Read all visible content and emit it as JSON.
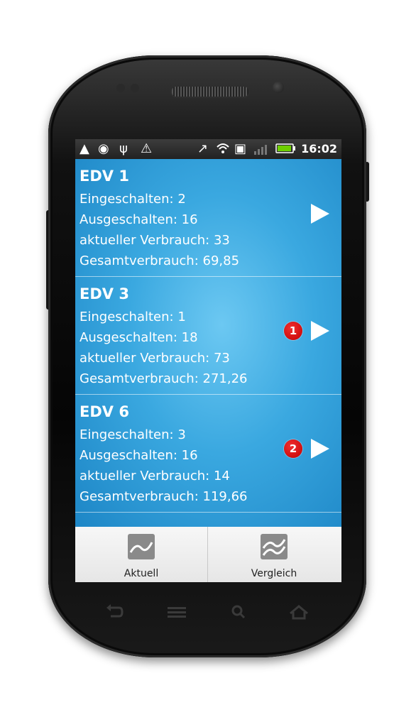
{
  "status_bar": {
    "time": "16:02",
    "icons": [
      "warning-icon",
      "location-icon",
      "usb-icon",
      "alert-icon",
      "missed-call-icon",
      "wifi-icon",
      "sim-icon",
      "signal-icon",
      "battery-icon"
    ]
  },
  "items": [
    {
      "title": "EDV 1",
      "eingeschalten": "Eingeschalten: 2",
      "ausgeschalten": "Ausgeschalten: 16",
      "verbrauch": "aktueller Verbrauch: 33",
      "gesamt": "Gesamtverbrauch: 69,85",
      "badge": ""
    },
    {
      "title": "EDV 3",
      "eingeschalten": "Eingeschalten: 1",
      "ausgeschalten": "Ausgeschalten: 18",
      "verbrauch": "aktueller Verbrauch: 73",
      "gesamt": "Gesamtverbrauch: 271,26",
      "badge": "1"
    },
    {
      "title": "EDV 6",
      "eingeschalten": "Eingeschalten: 3",
      "ausgeschalten": "Ausgeschalten: 16",
      "verbrauch": "aktueller Verbrauch: 14",
      "gesamt": "Gesamtverbrauch: 119,66",
      "badge": "2"
    }
  ],
  "tabs": [
    {
      "label": "Aktuell",
      "icon": "single-wave-chart-icon"
    },
    {
      "label": "Vergleich",
      "icon": "double-wave-chart-icon"
    }
  ],
  "colors": {
    "list_bg": "#3aa8e0",
    "badge": "#d40000",
    "tab_bg": "#eeeeee"
  }
}
